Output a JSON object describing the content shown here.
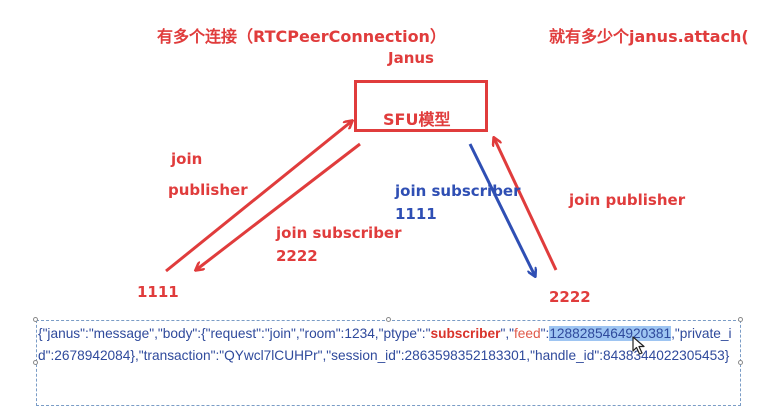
{
  "labels": {
    "top_left": "有多个连接（RTCPeerConnection）",
    "top_right": "就有多少个janus.attach(",
    "janus": "Janus",
    "sfu": "SFU模型",
    "join_line1": "join",
    "join_line2": "publisher",
    "left_subscriber": "join subscriber",
    "left_subscriber_id": "2222",
    "blue_subscriber": "join subscriber",
    "blue_subscriber_id": "1111",
    "right_publisher": "join publisher",
    "left_client": "1111",
    "right_client": "2222"
  },
  "json_snippet": {
    "part1": "{\"janus\":\"message\",\"body\":{\"request\":\"join\",\"room\":1234,\"ptype\":\"",
    "ptype_value": "subscriber",
    "part2": "\",\"",
    "feed_key": "feed",
    "part3": "\":",
    "feed_value": "1288285464920381",
    "part4": ",\"private_id\":2678942084},\"transaction\":\"QYwcl7lCUHPr\",\"session_id\":2863598352183301,\"handle_id\":8438344022305453}"
  },
  "colors": {
    "red": "#e03c3c",
    "blue": "#2f4fb4",
    "json_text": "#2f4a9c",
    "highlight": "#9ec5f2"
  }
}
